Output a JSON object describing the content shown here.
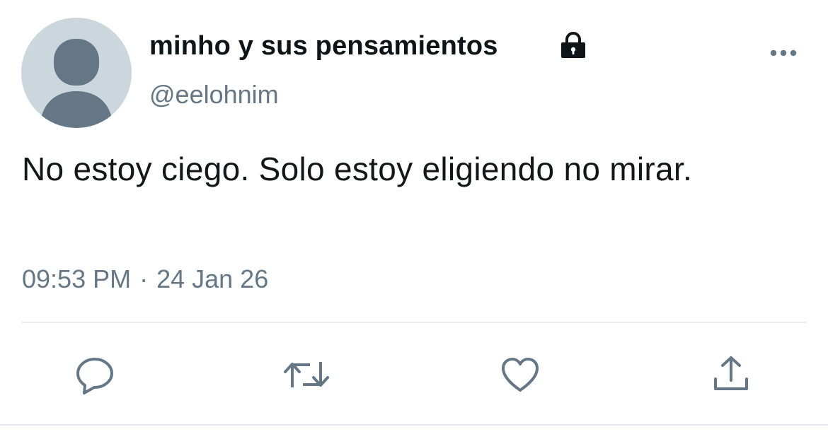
{
  "tweet": {
    "display_name": "minho y sus pensamientos",
    "handle": "@eelohnim",
    "text": "No estoy ciego. Solo estoy eligiendo no mirar.",
    "time": "09:53 PM",
    "separator": "·",
    "date": "24 Jan 26"
  },
  "icons": {
    "avatar": "default-avatar-silhouette",
    "lock": "lock-icon",
    "more": "more-horizontal-icon",
    "reply": "reply-icon",
    "retweet": "retweet-icon",
    "like": "heart-icon",
    "share": "share-icon"
  },
  "colors": {
    "primary_text": "#0f1419",
    "secondary_text": "#657786",
    "icon": "#657786",
    "avatar_bg": "#ccd6dd",
    "avatar_figure": "#657786",
    "divider": "#e6ecf0"
  }
}
